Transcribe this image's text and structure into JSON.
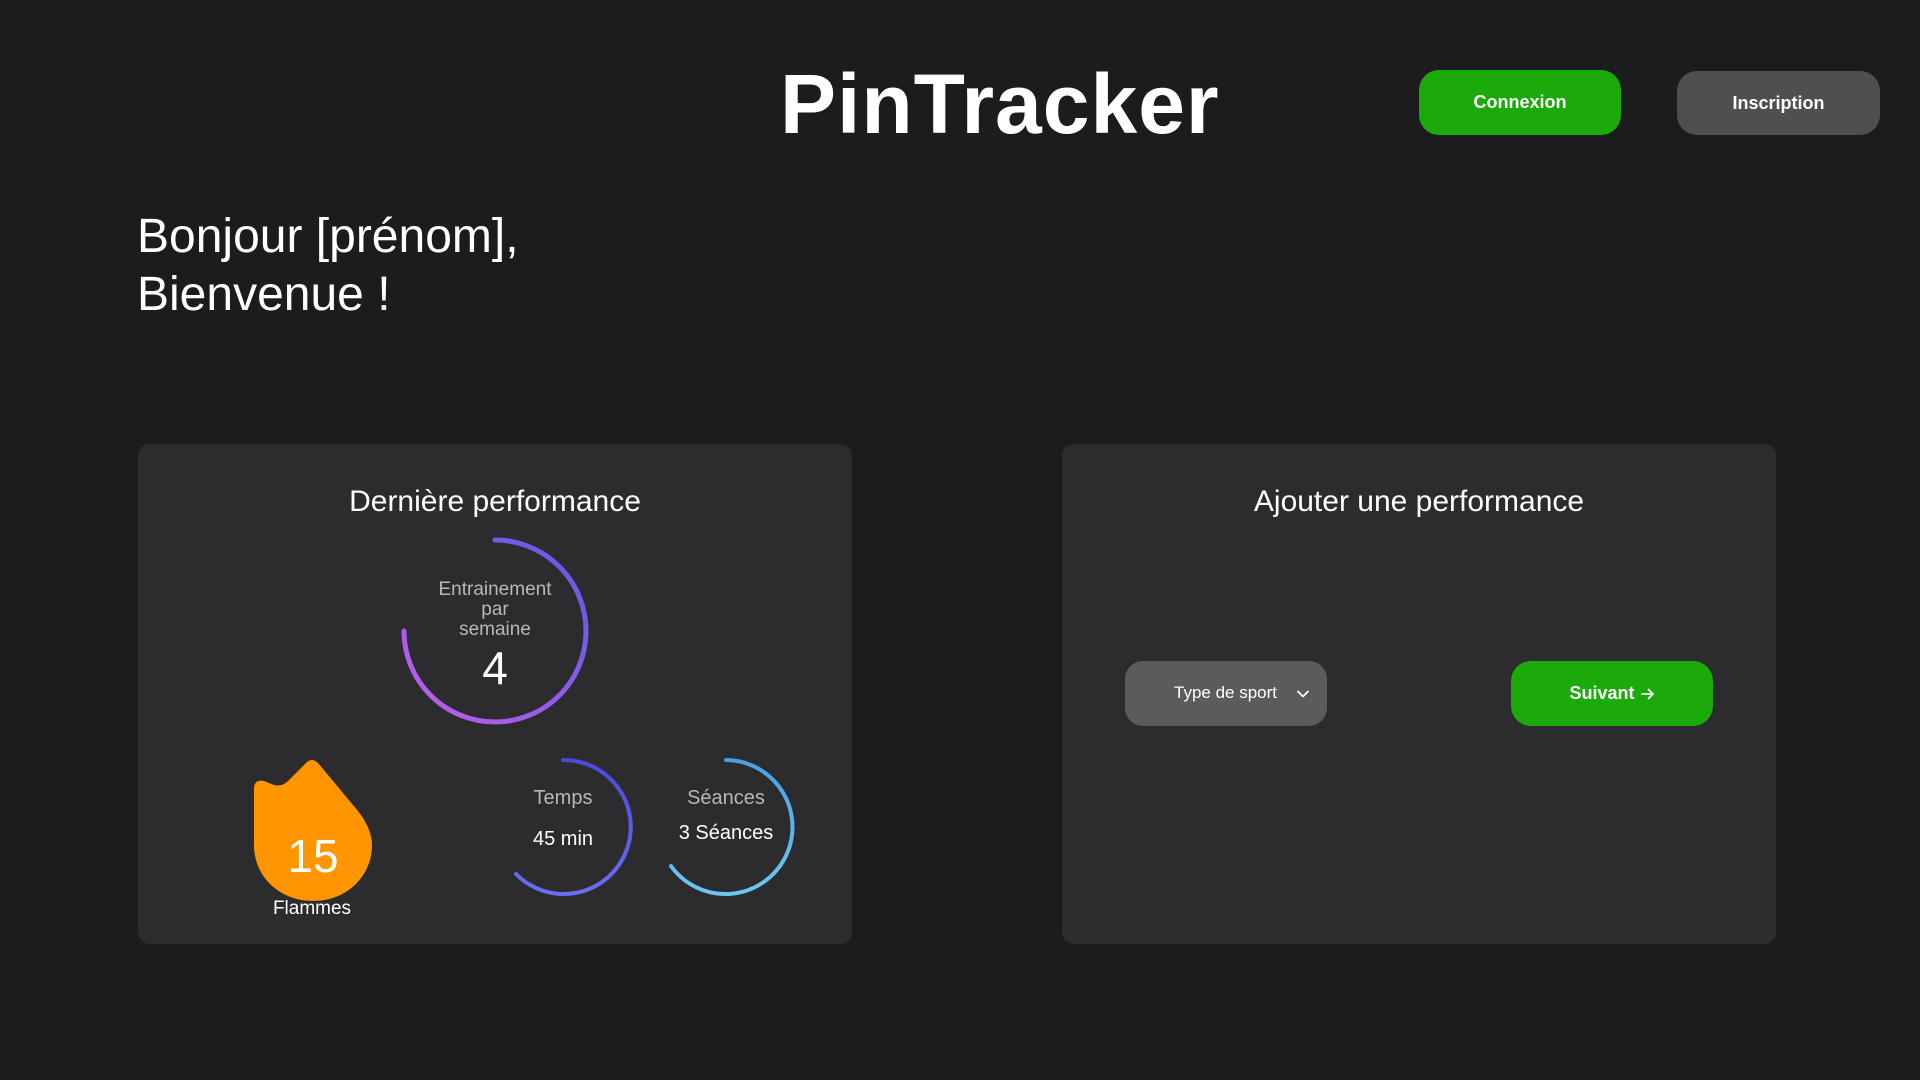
{
  "header": {
    "title": "PinTracker",
    "login_label": "Connexion",
    "signup_label": "Inscription"
  },
  "greeting": {
    "line1": "Bonjour [prénom],",
    "line2": "Bienvenue !"
  },
  "last_performance": {
    "title": "Dernière performance",
    "weekly": {
      "label_line1": "Entrainement",
      "label_line2": "par",
      "label_line3": "semaine",
      "value": "4"
    },
    "flames": {
      "value": "15",
      "label": "Flammes"
    },
    "time": {
      "label": "Temps",
      "value": "45 min"
    },
    "sessions": {
      "label": "Séances",
      "value": "3 Séances"
    }
  },
  "add_performance": {
    "title": "Ajouter une performance",
    "sport_select": {
      "selected": "Type de sport",
      "icon": "chevron-down-icon"
    },
    "next_label": "Suivant",
    "next_icon": "arrow-right-icon"
  },
  "colors": {
    "background": "#1c1c1e",
    "card": "#2c2c2e",
    "accent_green": "#1aab0a",
    "button_gray": "#4f4f52",
    "flame_orange": "#ff9500",
    "ring_purple_start": "#5b5be6",
    "ring_purple_end": "#b45fe8",
    "ring_blue_start": "#4a9fe6",
    "ring_blue_end": "#6ec6f0"
  }
}
